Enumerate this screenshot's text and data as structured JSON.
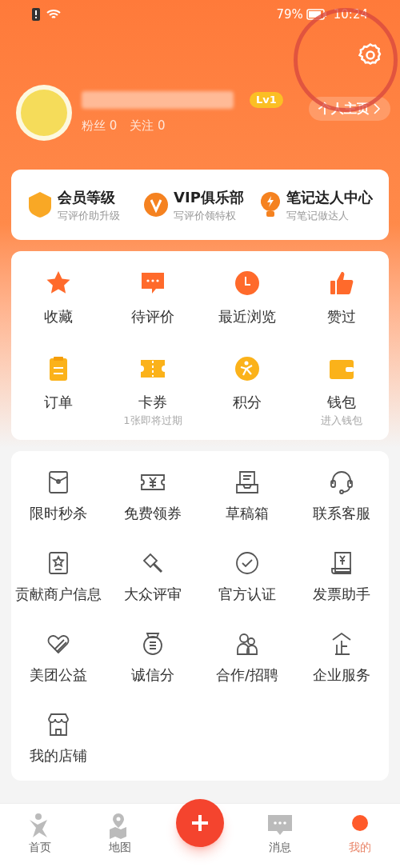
{
  "status_bar": {
    "battery": "79%",
    "time": "10:24"
  },
  "profile": {
    "level_badge": "Lv1",
    "fans": "粉丝 0",
    "following": "关注 0",
    "homepage_button": "个人主页"
  },
  "member_cards": [
    {
      "kind": "lv",
      "title": "会员等级",
      "subtitle": "写评价助升级"
    },
    {
      "kind": "vip",
      "title": "VIP俱乐部",
      "subtitle": "写评价领特权"
    },
    {
      "kind": "bulb",
      "title": "笔记达人中心",
      "subtitle": "写笔记做达人"
    }
  ],
  "quick_actions": [
    {
      "kind": "star",
      "label": "收藏"
    },
    {
      "kind": "comment",
      "label": "待评价"
    },
    {
      "kind": "clock",
      "label": "最近浏览"
    },
    {
      "kind": "thumb",
      "label": "赞过"
    },
    {
      "kind": "order",
      "label": "订单"
    },
    {
      "kind": "ticket",
      "label": "卡券",
      "sublabel": "1张即将过期"
    },
    {
      "kind": "points",
      "label": "积分"
    },
    {
      "kind": "wallet",
      "label": "钱包",
      "sublabel": "进入钱包"
    }
  ],
  "services": [
    {
      "kind": "envelope",
      "label": "限时秒杀"
    },
    {
      "kind": "coupon",
      "label": "免费领券"
    },
    {
      "kind": "tray",
      "label": "草稿箱"
    },
    {
      "kind": "headset",
      "label": "联系客服"
    },
    {
      "kind": "badge",
      "label": "贡献商户信息"
    },
    {
      "kind": "gavel",
      "label": "大众评审"
    },
    {
      "kind": "check",
      "label": "官方认证"
    },
    {
      "kind": "invoice",
      "label": "发票助手"
    },
    {
      "kind": "heart",
      "label": "美团公益"
    },
    {
      "kind": "medal",
      "label": "诚信分"
    },
    {
      "kind": "people",
      "label": "合作/招聘"
    },
    {
      "kind": "enterprise",
      "label": "企业服务"
    },
    {
      "kind": "shop",
      "label": "我的店铺"
    }
  ],
  "bottom_nav": [
    {
      "kind": "home",
      "label": "首页",
      "selected": false
    },
    {
      "kind": "map",
      "label": "地图",
      "selected": false
    },
    {
      "kind": "add"
    },
    {
      "kind": "message",
      "label": "消息",
      "selected": false
    },
    {
      "kind": "mine",
      "label": "我的",
      "selected": true
    }
  ]
}
